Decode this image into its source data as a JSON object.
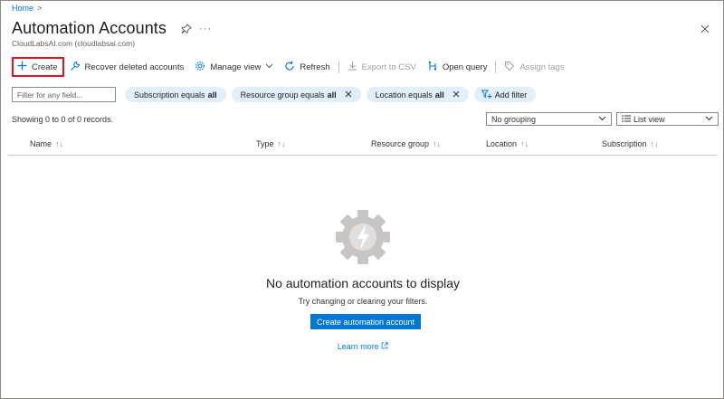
{
  "breadcrumb": {
    "home": "Home",
    "separator": ">"
  },
  "header": {
    "title": "Automation Accounts",
    "subtitle": "CloudLabsAI.com (cloudlabsai.com)",
    "more": "···"
  },
  "toolbar": {
    "create": "Create",
    "recover": "Recover deleted accounts",
    "manage_view": "Manage view",
    "refresh": "Refresh",
    "export_csv": "Export to CSV",
    "open_query": "Open query",
    "assign_tags": "Assign tags"
  },
  "filters": {
    "search_placeholder": "Filter for any field...",
    "pills": [
      {
        "label": "Subscription equals ",
        "value": "all"
      },
      {
        "label": "Resource group equals ",
        "value": "all"
      },
      {
        "label": "Location equals ",
        "value": "all"
      }
    ],
    "add_filter": "Add filter"
  },
  "records": "Showing 0 to 0 of 0 records.",
  "grouping": {
    "selected": "No grouping"
  },
  "view": {
    "selected": "List view"
  },
  "columns": [
    {
      "label": "Name",
      "sort": "↑↓"
    },
    {
      "label": "Type",
      "sort": "↑↓"
    },
    {
      "label": "Resource group",
      "sort": "↑↓"
    },
    {
      "label": "Location",
      "sort": "↑↓"
    },
    {
      "label": "Subscription",
      "sort": "↑↓"
    }
  ],
  "empty_state": {
    "title": "No automation accounts to display",
    "subtitle": "Try changing or clearing your filters.",
    "button": "Create automation account",
    "learn_more": "Learn more"
  },
  "colors": {
    "accent": "#0078d4",
    "highlight_border": "#e81123",
    "pill_bg": "#e1effa"
  }
}
